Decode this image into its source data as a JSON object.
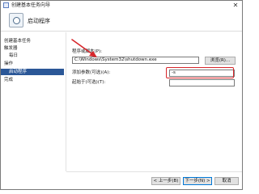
{
  "window": {
    "title": "创建基本任务向导",
    "close_glyph": "✕"
  },
  "header": {
    "title": "启动程序"
  },
  "sidebar": {
    "top_label": "创建基本任务",
    "items": [
      {
        "label": "触发器"
      },
      {
        "label": "每日"
      },
      {
        "label": "操作"
      },
      {
        "label": "启动程序",
        "selected": true
      },
      {
        "label": "完成"
      }
    ]
  },
  "form": {
    "program_label": "程序或脚本(P):",
    "program_value": "C:\\Windows\\System32\\shutdown.exe",
    "browse_label": "浏览(R)...",
    "args_label": "添加参数(可选)(A):",
    "args_value": "-s",
    "start_in_label": "起始于(可选)(T):",
    "start_in_value": ""
  },
  "footer": {
    "back_label": "< 上一步(B)",
    "next_label": "下一步(N) >",
    "cancel_label": "取消"
  },
  "colors": {
    "selection": "#2b5797",
    "annotation_red": "#d7262b"
  }
}
